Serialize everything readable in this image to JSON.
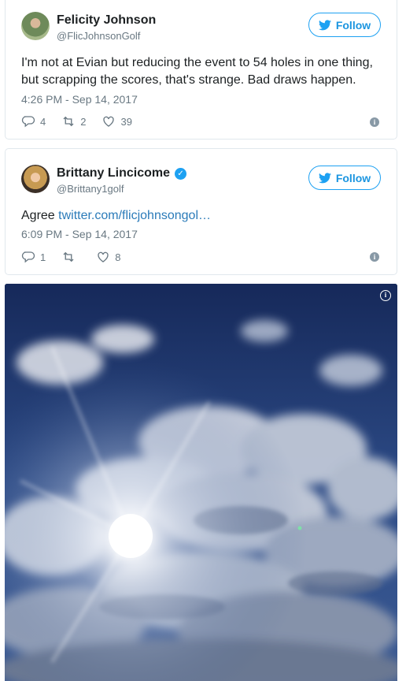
{
  "tweets": [
    {
      "name": "Felicity Johnson",
      "handle": "@FlicJohnsonGolf",
      "follow_label": "Follow",
      "text": "I'm not at Evian but reducing the event to 54 holes in one thing, but scrapping the scores, that's strange. Bad draws happen.",
      "timestamp": "4:26 PM - Sep 14, 2017",
      "replies": "4",
      "retweets": "2",
      "likes": "39"
    },
    {
      "name": "Brittany Lincicome",
      "handle": "@Brittany1golf",
      "verified": true,
      "follow_label": "Follow",
      "text_prefix": "Agree ",
      "link_text": "twitter.com/flicjohnsongol…",
      "timestamp": "6:09 PM - Sep 14, 2017",
      "replies": "1",
      "retweets": "",
      "likes": "8"
    }
  ],
  "icons": {
    "follow": "twitter-bird-icon",
    "reply": "reply-icon",
    "retweet": "retweet-icon",
    "like": "heart-icon",
    "info": "info-icon",
    "verified": "verified-badge-icon"
  },
  "colors": {
    "accent": "#1da1f2",
    "link": "#2b7bb9",
    "muted": "#697882",
    "sky": "#1f3563"
  }
}
